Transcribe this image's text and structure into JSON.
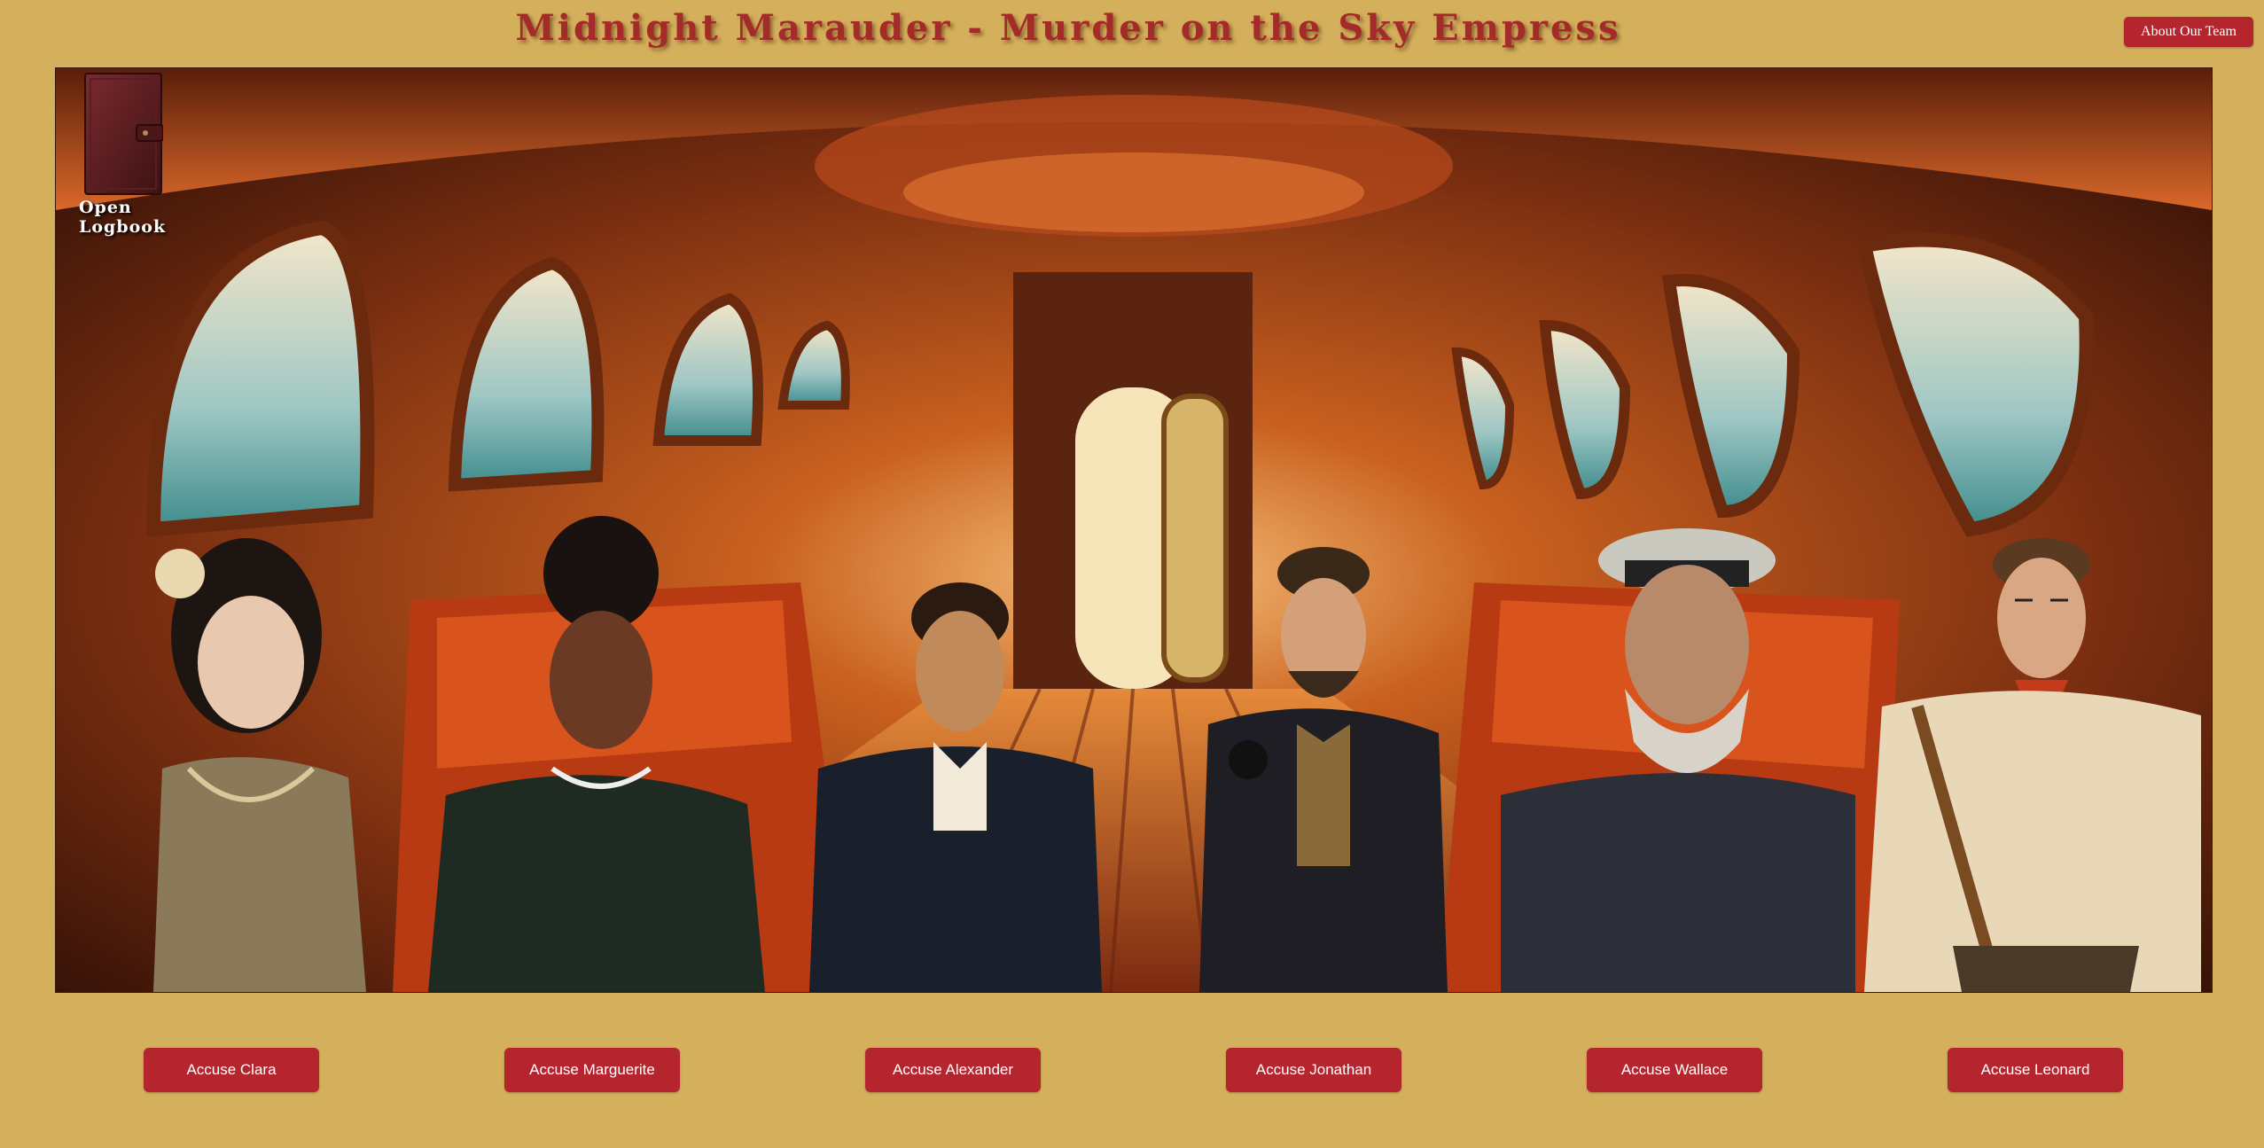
{
  "header": {
    "title": "Midnight Marauder - Murder on the Sky Empress",
    "about_label": "About Our Team"
  },
  "scene": {
    "logbook_label": "Open Logbook",
    "logbook_icon": "leather-book-icon"
  },
  "suspects": [
    {
      "name": "Clara",
      "accuse_label": "Accuse Clara"
    },
    {
      "name": "Marguerite",
      "accuse_label": "Accuse Marguerite"
    },
    {
      "name": "Alexander",
      "accuse_label": "Accuse Alexander"
    },
    {
      "name": "Jonathan",
      "accuse_label": "Accuse Jonathan"
    },
    {
      "name": "Wallace",
      "accuse_label": "Accuse Wallace"
    },
    {
      "name": "Leonard",
      "accuse_label": "Accuse Leonard"
    }
  ],
  "colors": {
    "background": "#d4b05c",
    "button": "#b5252d",
    "title": "#a52a2a"
  }
}
